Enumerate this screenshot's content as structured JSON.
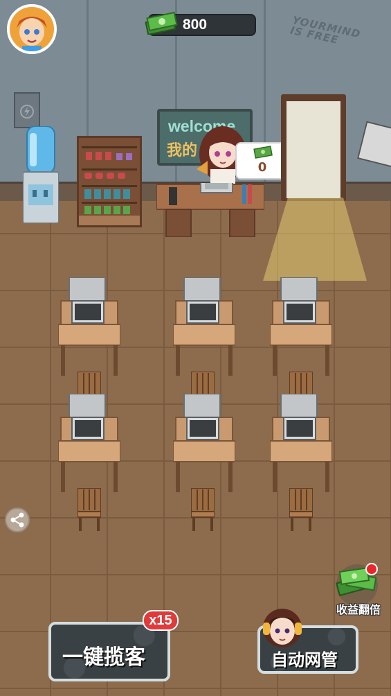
{
  "hud": {
    "money": "800",
    "avatar_icon": "player-avatar-icon",
    "money_icon": "cash-stack-icon"
  },
  "scene": {
    "graffiti_line1": "YOURMIND",
    "graffiti_line2": "IS FREE",
    "welcome_line1": "welcome",
    "welcome_line2": "我的",
    "counter_bubble_value": "0"
  },
  "buttons": {
    "double_income_label": "收益翻倍",
    "attract_customers_label": "一键揽客",
    "attract_customers_badge": "x15",
    "auto_manager_label": "自动网管"
  },
  "colors": {
    "wall": "#7d8b94",
    "floor": "#8d6c4d",
    "button_bg": "#3a4145",
    "badge_red": "#e03b3b"
  }
}
